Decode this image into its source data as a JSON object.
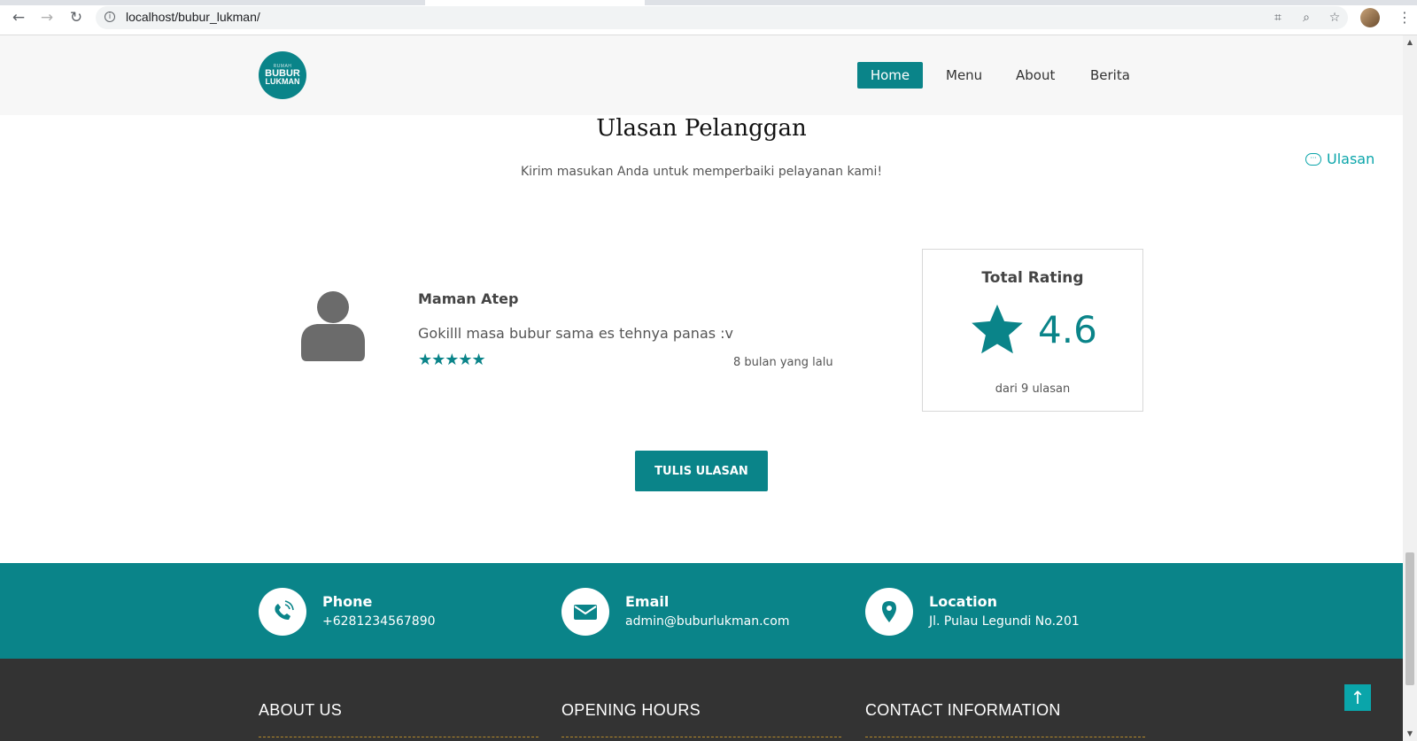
{
  "browser": {
    "url": "localhost/bubur_lukman/",
    "back_icon": "arrow-left-icon",
    "forward_icon": "arrow-right-icon",
    "reload_icon": "reload-icon"
  },
  "site": {
    "logo": {
      "line1": "BUBUR",
      "line2": "LUKMAN",
      "top": "RUMAH"
    },
    "nav": [
      {
        "label": "Home",
        "active": true
      },
      {
        "label": "Menu",
        "active": false
      },
      {
        "label": "About",
        "active": false
      },
      {
        "label": "Berita",
        "active": false
      }
    ]
  },
  "reviews": {
    "title": "Ulasan Pelanggan",
    "subtitle": "Kirim masukan Anda untuk memperbaiki pelayanan kami!",
    "side_link": "Ulasan",
    "item": {
      "name": "Maman Atep",
      "text": "Gokilll masa bubur sama es tehnya panas :v",
      "stars": 5,
      "stars_glyph": "★★★★★",
      "time": "8 bulan yang lalu"
    },
    "total": {
      "title": "Total Rating",
      "value": "4.6",
      "count": "dari 9 ulasan"
    },
    "write_button": "TULIS ULASAN"
  },
  "contact": {
    "phone": {
      "label": "Phone",
      "value": "+6281234567890",
      "icon": "phone-icon"
    },
    "email": {
      "label": "Email",
      "value": "admin@buburlukman.com",
      "icon": "envelope-icon"
    },
    "location": {
      "label": "Location",
      "value": "Jl. Pulau Legundi No.201",
      "icon": "map-pin-icon"
    }
  },
  "footer": {
    "about": "ABOUT US",
    "hours": "OPENING HOURS",
    "info": "CONTACT INFORMATION"
  },
  "colors": {
    "brand": "#0a8489",
    "accent": "#0aa5aa",
    "footer_bg": "#333333",
    "divider": "#b68b2b"
  }
}
